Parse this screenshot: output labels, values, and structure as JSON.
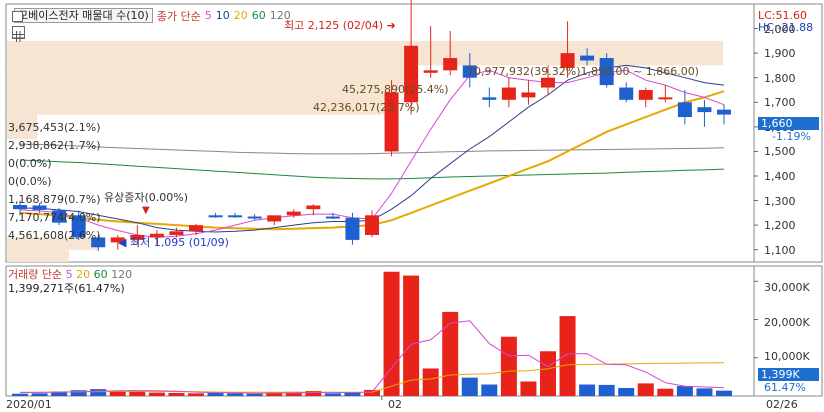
{
  "header": {
    "stock_label": "모베이스전자 매물대 수(10)",
    "ma_label": "종가 단순",
    "ma_periods": [
      "5",
      "10",
      "20",
      "60",
      "120"
    ],
    "ma_colors": [
      "#d24bd2",
      "#2c3e8f",
      "#e8a800",
      "#1a8a3c",
      "#777777"
    ],
    "lc_label": "LC:51.60",
    "hc_label": "HC:-21.88"
  },
  "price_axis": {
    "ticks": [
      "2,000",
      "1,900",
      "1,800",
      "1,700",
      "1,600",
      "1,500",
      "1,400",
      "1,300",
      "1,200",
      "1,100"
    ],
    "current_price": "1,660",
    "current_change": "-1.19%"
  },
  "volume_axis": {
    "ticks": [
      "30,000K",
      "20,000K",
      "10,000K"
    ],
    "current_volume": "1,399K",
    "current_ratio": "61.47%"
  },
  "volume_header": {
    "label": "거래량 단순",
    "periods": [
      "5",
      "20",
      "60",
      "120"
    ],
    "current_text": "1,399,271주(61.47%)"
  },
  "x_axis": {
    "labels": [
      "2020/01",
      "02",
      "02/26"
    ]
  },
  "annotations": {
    "high": "최고 2,125 (02/04)",
    "low": "최저 1,095 (01/09)",
    "event": "유상증자(0.00%)"
  },
  "volume_profile": [
    {
      "price_range": [
        1850,
        1950
      ],
      "text": "70,977,932(39.32%)1,850.00 ~ 1,866.00)"
    },
    {
      "price_range": [
        1750,
        1850
      ],
      "text": "45,275,890(25.4%)"
    },
    {
      "price_range": [
        1650,
        1750
      ],
      "text": "42,236,017(23.7%)"
    },
    {
      "price_range": [
        1550,
        1650
      ],
      "text": "3,675,453(2.1%)"
    },
    {
      "price_range": [
        1450,
        1550
      ],
      "text": "2,938,862(1.7%)"
    },
    {
      "price_range": [
        1350,
        1450
      ],
      "text": "0(0.0%)"
    },
    {
      "price_range": [
        1250,
        1350
      ],
      "text": "0(0.0%)"
    },
    {
      "price_range": [
        1150,
        1250
      ],
      "text": "1,168,879(0.7%)"
    },
    {
      "price_range": [
        1100,
        1150
      ],
      "text": "7,170,774(4.0%)"
    },
    {
      "price_range": [
        1050,
        1100
      ],
      "text": "4,561,608(2.6%)"
    }
  ],
  "chart_data": {
    "type": "candlestick",
    "ylim": [
      1050,
      2100
    ],
    "volume_ylim": [
      0,
      34000
    ],
    "candles": [
      {
        "o": 1282,
        "h": 1300,
        "l": 1240,
        "c": 1265,
        "v": 600
      },
      {
        "o": 1280,
        "h": 1290,
        "l": 1250,
        "c": 1262,
        "v": 700
      },
      {
        "o": 1260,
        "h": 1270,
        "l": 1200,
        "c": 1210,
        "v": 1200
      },
      {
        "o": 1240,
        "h": 1260,
        "l": 1140,
        "c": 1150,
        "v": 1500
      },
      {
        "o": 1150,
        "h": 1160,
        "l": 1095,
        "c": 1110,
        "v": 1800
      },
      {
        "o": 1130,
        "h": 1160,
        "l": 1100,
        "c": 1150,
        "v": 1300
      },
      {
        "o": 1140,
        "h": 1200,
        "l": 1120,
        "c": 1160,
        "v": 1400
      },
      {
        "o": 1150,
        "h": 1180,
        "l": 1120,
        "c": 1165,
        "v": 900
      },
      {
        "o": 1160,
        "h": 1190,
        "l": 1150,
        "c": 1175,
        "v": 800
      },
      {
        "o": 1175,
        "h": 1205,
        "l": 1160,
        "c": 1200,
        "v": 700
      },
      {
        "o": 1240,
        "h": 1250,
        "l": 1230,
        "c": 1235,
        "v": 800
      },
      {
        "o": 1240,
        "h": 1250,
        "l": 1230,
        "c": 1235,
        "v": 700
      },
      {
        "o": 1235,
        "h": 1245,
        "l": 1220,
        "c": 1230,
        "v": 600
      },
      {
        "o": 1215,
        "h": 1240,
        "l": 1200,
        "c": 1240,
        "v": 900
      },
      {
        "o": 1240,
        "h": 1265,
        "l": 1230,
        "c": 1255,
        "v": 1100
      },
      {
        "o": 1265,
        "h": 1285,
        "l": 1240,
        "c": 1280,
        "v": 1300
      },
      {
        "o": 1235,
        "h": 1250,
        "l": 1225,
        "c": 1230,
        "v": 700
      },
      {
        "o": 1230,
        "h": 1250,
        "l": 1120,
        "c": 1140,
        "v": 900
      },
      {
        "o": 1160,
        "h": 1260,
        "l": 1150,
        "c": 1240,
        "v": 1600
      },
      {
        "o": 1500,
        "h": 1790,
        "l": 1480,
        "c": 1740,
        "v": 32500
      },
      {
        "o": 1700,
        "h": 2125,
        "l": 1650,
        "c": 1930,
        "v": 31500
      },
      {
        "o": 1820,
        "h": 2010,
        "l": 1800,
        "c": 1830,
        "v": 7200
      },
      {
        "o": 1830,
        "h": 1990,
        "l": 1810,
        "c": 1880,
        "v": 22000
      },
      {
        "o": 1850,
        "h": 1900,
        "l": 1760,
        "c": 1800,
        "v": 4800
      },
      {
        "o": 1720,
        "h": 1760,
        "l": 1680,
        "c": 1710,
        "v": 3000
      },
      {
        "o": 1710,
        "h": 1800,
        "l": 1680,
        "c": 1760,
        "v": 15500
      },
      {
        "o": 1720,
        "h": 1790,
        "l": 1690,
        "c": 1740,
        "v": 3800
      },
      {
        "o": 1760,
        "h": 1850,
        "l": 1730,
        "c": 1800,
        "v": 11700
      },
      {
        "o": 1840,
        "h": 2030,
        "l": 1800,
        "c": 1900,
        "v": 20900
      },
      {
        "o": 1890,
        "h": 1920,
        "l": 1850,
        "c": 1870,
        "v": 3000
      },
      {
        "o": 1880,
        "h": 1900,
        "l": 1760,
        "c": 1770,
        "v": 2900
      },
      {
        "o": 1760,
        "h": 1780,
        "l": 1700,
        "c": 1710,
        "v": 2100
      },
      {
        "o": 1710,
        "h": 1760,
        "l": 1680,
        "c": 1750,
        "v": 3300
      },
      {
        "o": 1720,
        "h": 1770,
        "l": 1700,
        "c": 1720,
        "v": 1900
      },
      {
        "o": 1700,
        "h": 1750,
        "l": 1610,
        "c": 1640,
        "v": 2600
      },
      {
        "o": 1680,
        "h": 1710,
        "l": 1600,
        "c": 1660,
        "v": 2000
      },
      {
        "o": 1670,
        "h": 1690,
        "l": 1610,
        "c": 1650,
        "v": 1399
      }
    ],
    "ma5": [
      1262,
      1258,
      1250,
      1230,
      1200,
      1178,
      1160,
      1150,
      1155,
      1165,
      1180,
      1200,
      1220,
      1230,
      1238,
      1245,
      1245,
      1230,
      1225,
      1330,
      1460,
      1590,
      1710,
      1810,
      1830,
      1800,
      1790,
      1780,
      1780,
      1800,
      1820,
      1830,
      1790,
      1770,
      1740,
      1720,
      1690
    ],
    "ma10": [
      1270,
      1268,
      1262,
      1255,
      1240,
      1225,
      1210,
      1190,
      1180,
      1175,
      1172,
      1175,
      1180,
      1190,
      1200,
      1210,
      1215,
      1215,
      1220,
      1265,
      1320,
      1390,
      1450,
      1510,
      1560,
      1620,
      1680,
      1730,
      1790,
      1820,
      1840,
      1850,
      1840,
      1820,
      1800,
      1780,
      1770
    ],
    "ma20": [
      1250,
      1245,
      1238,
      1230,
      1222,
      1215,
      1210,
      1205,
      1200,
      1195,
      1190,
      1187,
      1185,
      1183,
      1185,
      1188,
      1190,
      1195,
      1200,
      1220,
      1250,
      1280,
      1310,
      1340,
      1370,
      1400,
      1430,
      1460,
      1500,
      1540,
      1580,
      1610,
      1640,
      1670,
      1700,
      1720,
      1745
    ],
    "ma60": [
      1465,
      1462,
      1458,
      1455,
      1450,
      1445,
      1440,
      1435,
      1430,
      1425,
      1420,
      1415,
      1410,
      1405,
      1400,
      1395,
      1392,
      1390,
      1388,
      1388,
      1390,
      1393,
      1396,
      1398,
      1400,
      1402,
      1404,
      1406,
      1408,
      1410,
      1412,
      1415,
      1418,
      1420,
      1423,
      1425,
      1428
    ],
    "ma120": [
      1530,
      1528,
      1525,
      1522,
      1518,
      1515,
      1512,
      1509,
      1506,
      1503,
      1500,
      1497,
      1495,
      1493,
      1491,
      1490,
      1490,
      1490,
      1491,
      1493,
      1495,
      1497,
      1499,
      1500,
      1502,
      1503,
      1504,
      1505,
      1506,
      1507,
      1508,
      1509,
      1510,
      1511,
      1512,
      1513,
      1515
    ],
    "vol_ma5": [
      900,
      950,
      1000,
      1100,
      1250,
      1380,
      1420,
      1380,
      1240,
      1020,
      900,
      800,
      740,
      760,
      820,
      920,
      940,
      900,
      1040,
      7340,
      13560,
      14700,
      19040,
      19660,
      13700,
      10500,
      10660,
      7660,
      11000,
      11080,
      8300,
      8140,
      6260,
      3500,
      2540,
      2380,
      2160
    ],
    "vol_ma20": [
      1000,
      1000,
      1050,
      1100,
      1150,
      1200,
      1200,
      1200,
      1150,
      1100,
      1050,
      1000,
      1000,
      1000,
      1000,
      1000,
      1000,
      1000,
      1000,
      2600,
      4150,
      4450,
      5500,
      5700,
      5800,
      6500,
      6600,
      7150,
      8150,
      8250,
      8350,
      8400,
      8500,
      8550,
      8600,
      8650,
      8700
    ]
  }
}
